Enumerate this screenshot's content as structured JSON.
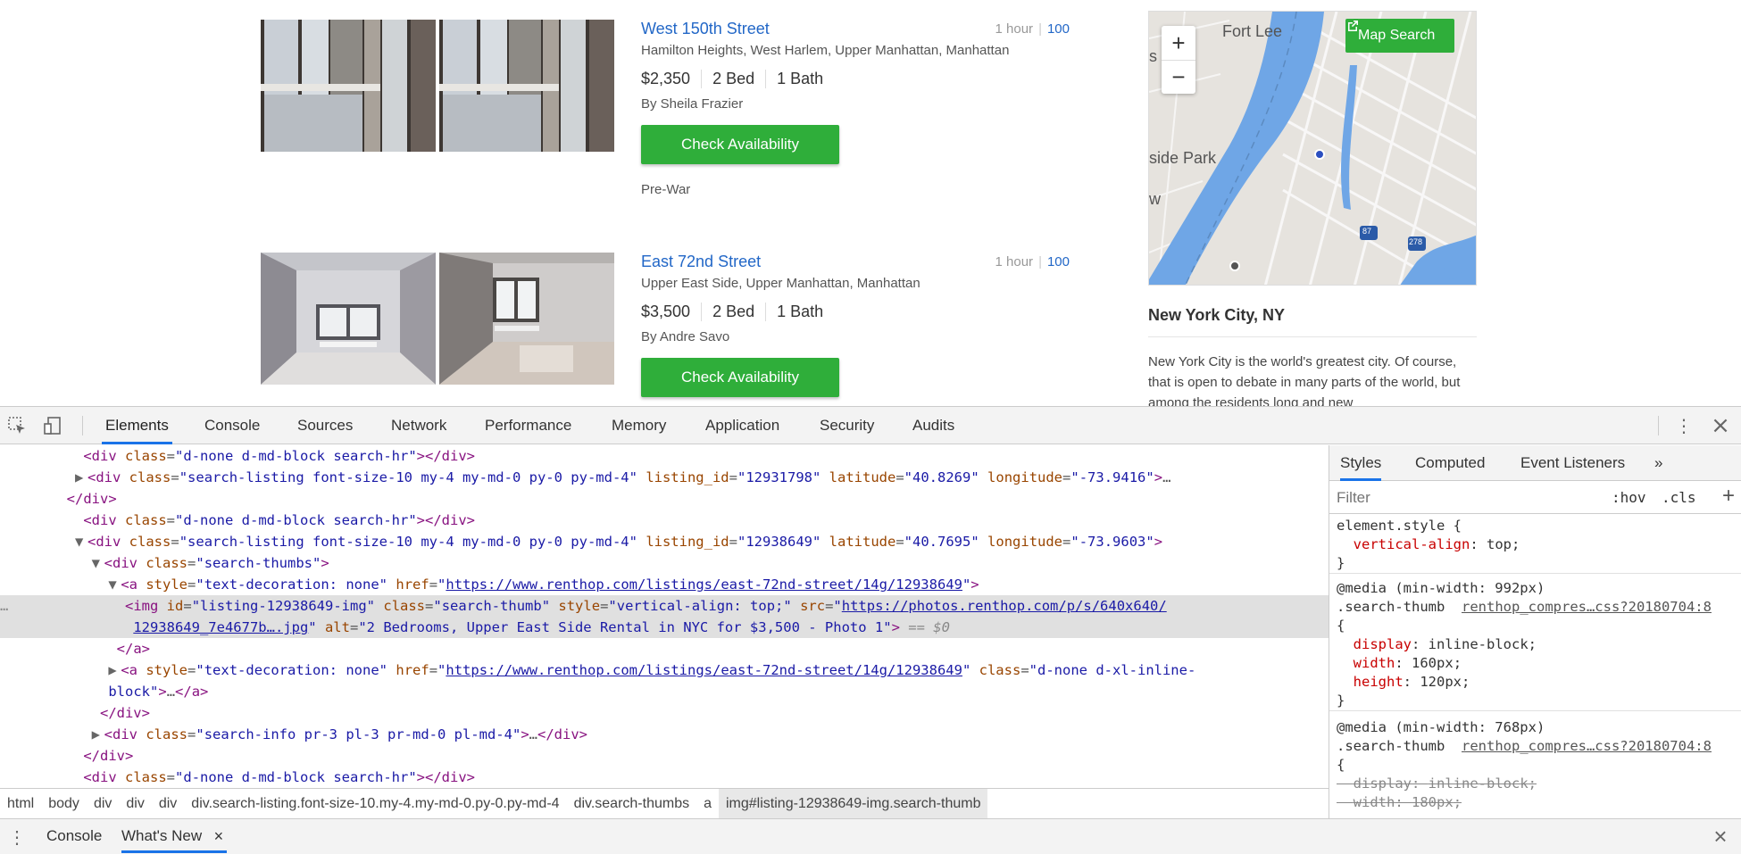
{
  "listings": [
    {
      "title": "West 150th Street",
      "time": "1 hour",
      "score": "100",
      "neighborhood": "Hamilton Heights, West Harlem, Upper Manhattan, Manhattan",
      "price": "$2,350",
      "beds": "2 Bed",
      "baths": "1 Bath",
      "agent": "By Sheila Frazier",
      "cta": "Check Availability",
      "tag": "Pre-War"
    },
    {
      "title": "East 72nd Street",
      "time": "1 hour",
      "score": "100",
      "neighborhood": "Upper East Side, Upper Manhattan, Manhattan",
      "price": "$3,500",
      "beds": "2 Bed",
      "baths": "1 Bath",
      "agent": "By Andre Savo",
      "cta": "Check Availability"
    }
  ],
  "map": {
    "zoom_in": "+",
    "zoom_out": "−",
    "search_label": "Map Search",
    "labels": {
      "fort_lee": "Fort Lee",
      "park": "side Park",
      "s": "s",
      "w": "w",
      "shield1": "87",
      "shield2": "278"
    }
  },
  "city": {
    "title": "New York City, NY",
    "description": "New York City is the world's greatest city. Of course, that is open to debate in many parts of the world, but among the residents long and new"
  },
  "devtools": {
    "tabs": [
      "Elements",
      "Console",
      "Sources",
      "Network",
      "Performance",
      "Memory",
      "Application",
      "Security",
      "Audits"
    ],
    "active_tab": "Elements",
    "styles_tabs": [
      "Styles",
      "Computed",
      "Event Listeners"
    ],
    "styles_more": "»",
    "filter_placeholder": "Filter",
    "hov": ":hov",
    "cls": ".cls",
    "add": "+",
    "breadcrumbs": [
      "html",
      "body",
      "div",
      "div",
      "div",
      "div.search-listing.font-size-10.my-4.my-md-0.py-0.py-md-4",
      "div.search-thumbs",
      "a",
      "img#listing-12938649-img.search-thumb"
    ],
    "drawer_tabs": [
      "Console",
      "What's New"
    ],
    "drawer_close": "×",
    "close": "×",
    "more": "⋮",
    "dom": {
      "hr_class": "d-none d-md-block search-hr",
      "listing_class": "search-listing font-size-10 my-4 my-md-0 py-0 py-md-4",
      "listing1_id": "12931798",
      "listing1_lat": "40.8269",
      "listing1_lng": "-73.9416",
      "listing2_id": "12938649",
      "listing2_lat": "40.7695",
      "listing2_lng": "-73.9603",
      "thumbs_class": "search-thumbs",
      "a_style": "text-decoration: none",
      "a_href": "https://www.renthop.com/listings/east-72nd-street/14g/12938649",
      "img_id": "listing-12938649-img",
      "img_class": "search-thumb",
      "img_style": "vertical-align: top;",
      "img_src_1": "https://photos.renthop.com/p/s/640x640/",
      "img_src_2": "12938649_7e4677b….jpg",
      "img_alt": "2 Bedrooms, Upper East Side Rental in NYC for $3,500 - Photo 1",
      "eq": "== $0",
      "a2_class_1": "d-none d-xl-inline-",
      "a2_class_2": "block",
      "info_class": "search-info pr-3 pl-3 pr-md-0 pl-md-4"
    },
    "styles": {
      "element_selector": "element.style",
      "element_prop": "vertical-align",
      "element_val": "top",
      "media1": "@media (min-width: 992px)",
      "media2": "@media (min-width: 768px)",
      "selector": ".search-thumb",
      "source": "renthop_compres…css?20180704:8",
      "display_prop": "display",
      "display_val": "inline-block",
      "width_prop": "width",
      "width1": "160px",
      "height_prop": "height",
      "height1": "120px",
      "width2": "180px"
    }
  }
}
